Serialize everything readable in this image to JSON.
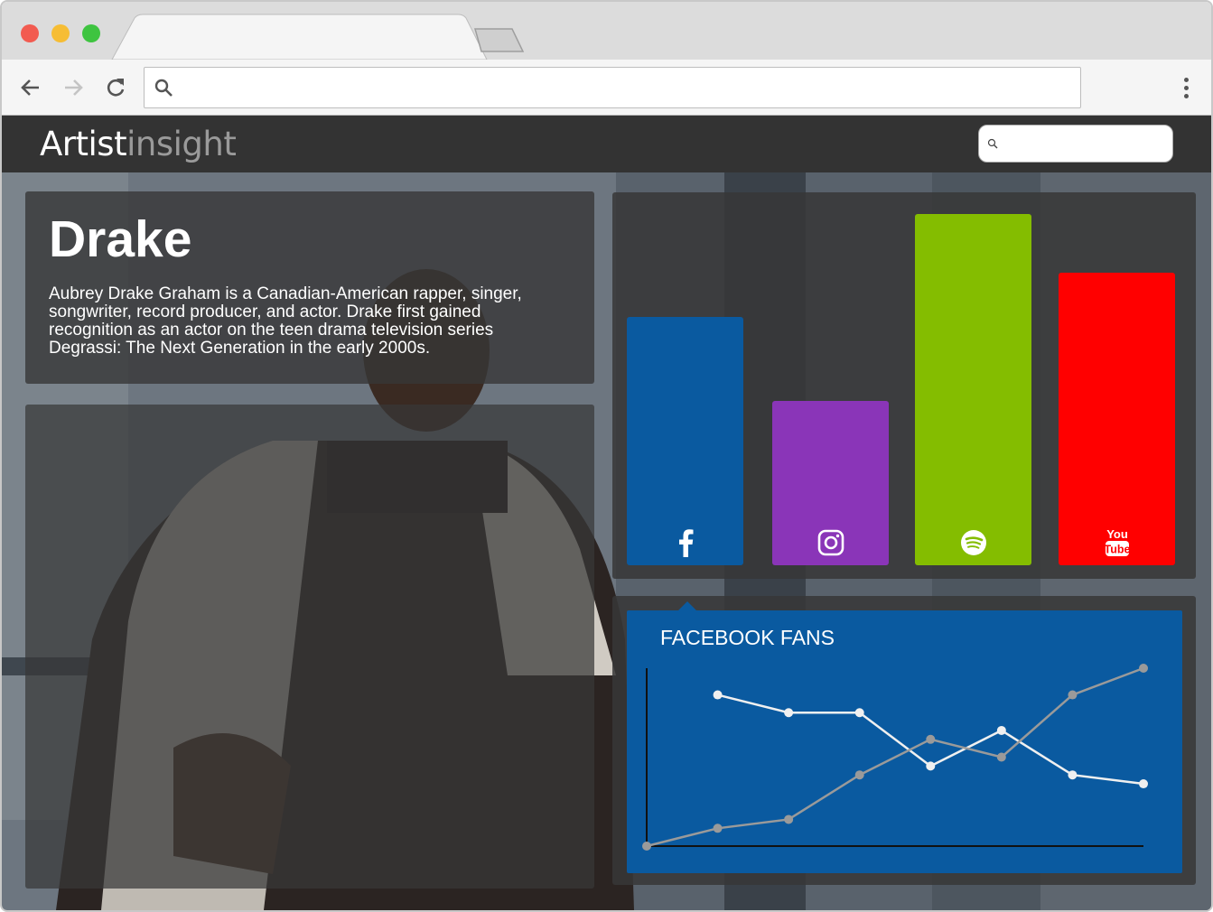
{
  "browser": {
    "url": ""
  },
  "header": {
    "logo_part1": "Artist",
    "logo_part2": "insight",
    "search_placeholder": ""
  },
  "artist": {
    "name": "Drake",
    "bio": "Aubrey Drake Graham is a Canadian-American rapper, singer, songwriter, record producer, and actor. Drake first gained recognition as an actor on the teen drama television series Degrassi: The Next Generation in the early 2000s."
  },
  "platforms": [
    {
      "name": "facebook",
      "icon": "facebook-icon",
      "color": "#0a5aa0",
      "level": 0.68
    },
    {
      "name": "instagram",
      "icon": "instagram-icon",
      "color": "#8a35b8",
      "level": 0.45
    },
    {
      "name": "spotify",
      "icon": "spotify-icon",
      "color": "#84bd00",
      "level": 0.96
    },
    {
      "name": "youtube",
      "icon": "youtube-icon",
      "color": "#ff0000",
      "level": 0.8
    }
  ],
  "chart_data": {
    "type": "line",
    "title": "FACEBOOK FANS",
    "xlabel": "",
    "ylabel": "",
    "x": [
      0,
      1,
      2,
      3,
      4,
      5,
      6,
      7
    ],
    "ylim": [
      0,
      100
    ],
    "series": [
      {
        "color": "#f0f0f0",
        "values": [
          null,
          85,
          75,
          75,
          45,
          65,
          40,
          35
        ]
      },
      {
        "color": "#9a9a9a",
        "values": [
          0,
          10,
          15,
          40,
          60,
          50,
          85,
          100
        ]
      }
    ]
  }
}
